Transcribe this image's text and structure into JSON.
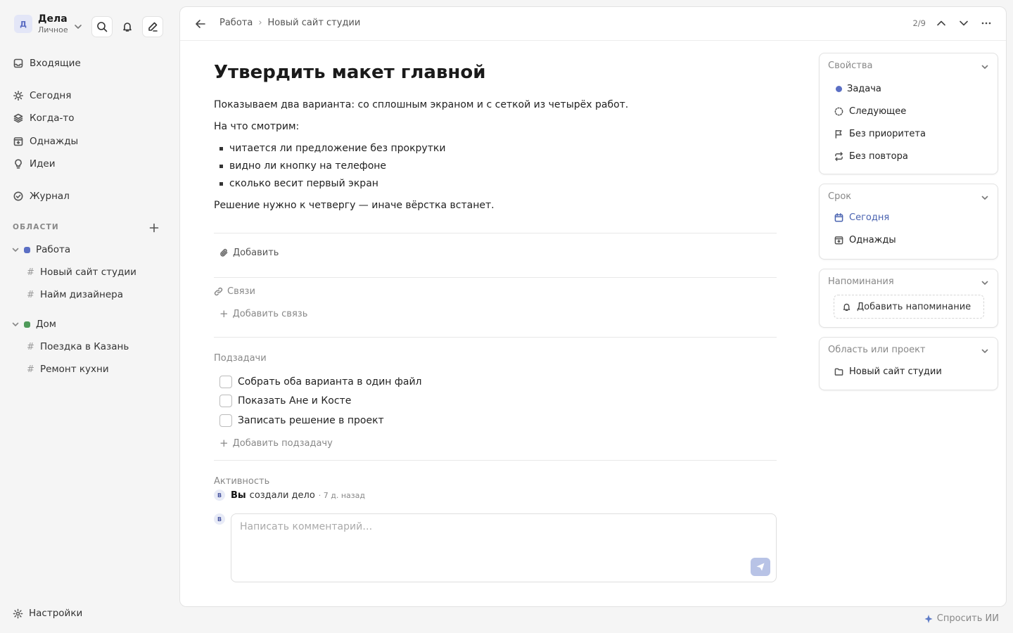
{
  "workspace": {
    "avatar": "Д",
    "name": "Дела",
    "subtitle": "Личное"
  },
  "nav": {
    "inbox": "Входящие",
    "today": "Сегодня",
    "someday": "Когда-то",
    "once": "Однажды",
    "ideas": "Идеи",
    "journal": "Журнал",
    "settings": "Настройки"
  },
  "areas": {
    "label": "ОБЛАСТИ",
    "items": [
      {
        "name": "Работа",
        "color": "#5b6fc4",
        "projects": [
          "Новый сайт студии",
          "Найм дизайнера"
        ]
      },
      {
        "name": "Дом",
        "color": "#4f9a5a",
        "projects": [
          "Поездка в Казань",
          "Ремонт кухни"
        ]
      }
    ]
  },
  "topbar": {
    "breadcrumb": [
      "Работа",
      "Новый сайт студии"
    ],
    "breadcrumb_sep": "›",
    "pager": "2/9"
  },
  "task": {
    "title": "Утвердить макет главной",
    "description": "Показываем два варианта: со сплошным экраном и с сеткой из четырёх работ.",
    "lead": "На что смотрим:",
    "bullets": [
      "читается ли предложение без прокрутки",
      "видно ли кнопку на телефоне",
      "сколько весит первый экран"
    ],
    "closing": "Решение нужно к четвергу — иначе вёрстка встанет.",
    "attach_label": "Добавить",
    "links_label": "Связи",
    "add_link": "Добавить связь",
    "subtasks_label": "Подзадачи",
    "subtasks": [
      {
        "text": "Собрать оба варианта в один файл",
        "done": false
      },
      {
        "text": "Показать Ане и Косте",
        "done": false
      },
      {
        "text": "Записать решение в проект",
        "done": false
      }
    ],
    "add_subtask": "Добавить подзадачу",
    "activity_label": "Активность",
    "activity": {
      "avatar": "В",
      "who": "Вы",
      "what": "создали дело",
      "when": "· 7 д. назад"
    },
    "comment_avatar": "В",
    "comment_placeholder": "Написать комментарий…"
  },
  "properties": {
    "title": "Свойства",
    "type": "Задача",
    "type_color": "#5b6fc4",
    "status": "Следующее",
    "priority": "Без приоритета",
    "repeat": "Без повтора"
  },
  "due": {
    "title": "Срок",
    "today": "Сегодня",
    "once": "Однажды"
  },
  "reminders": {
    "title": "Напоминания",
    "add": "Добавить напоминание"
  },
  "project": {
    "title": "Область или проект",
    "value": "Новый сайт студии"
  },
  "ask_ai": "Спросить ИИ"
}
